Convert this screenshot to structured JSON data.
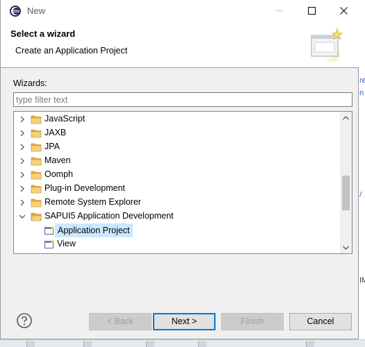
{
  "window": {
    "title": "New"
  },
  "header": {
    "title": "Select a wizard",
    "description": "Create an Application Project"
  },
  "wizards": {
    "label": "Wizards:",
    "filter_placeholder": "type filter text",
    "filter_value": "",
    "items": [
      {
        "label": "JavaScript",
        "expanded": false,
        "level": 0,
        "icon": "folder-icon"
      },
      {
        "label": "JAXB",
        "expanded": false,
        "level": 0,
        "icon": "folder-icon"
      },
      {
        "label": "JPA",
        "expanded": false,
        "level": 0,
        "icon": "folder-icon"
      },
      {
        "label": "Maven",
        "expanded": false,
        "level": 0,
        "icon": "folder-icon"
      },
      {
        "label": "Oomph",
        "expanded": false,
        "level": 0,
        "icon": "folder-icon"
      },
      {
        "label": "Plug-in Development",
        "expanded": false,
        "level": 0,
        "icon": "folder-icon"
      },
      {
        "label": "Remote System Explorer",
        "expanded": false,
        "level": 0,
        "icon": "folder-icon"
      },
      {
        "label": "SAPUI5 Application Development",
        "expanded": true,
        "level": 0,
        "icon": "open-folder-icon"
      },
      {
        "label": "Application Project",
        "level": 1,
        "selected": true,
        "icon": "application-project-icon"
      },
      {
        "label": "View",
        "level": 1,
        "icon": "view-wizard-icon"
      }
    ]
  },
  "buttons": {
    "back": "< Back",
    "next": "Next >",
    "finish": "Finish",
    "cancel": "Cancel"
  },
  "background_fragments": {
    "right_glyphs": [
      "re",
      "n",
      "/",
      "IM"
    ]
  },
  "colors": {
    "selection": "#cce8ff",
    "default_button_border": "#0078d7",
    "folder": "#e8b64c"
  }
}
